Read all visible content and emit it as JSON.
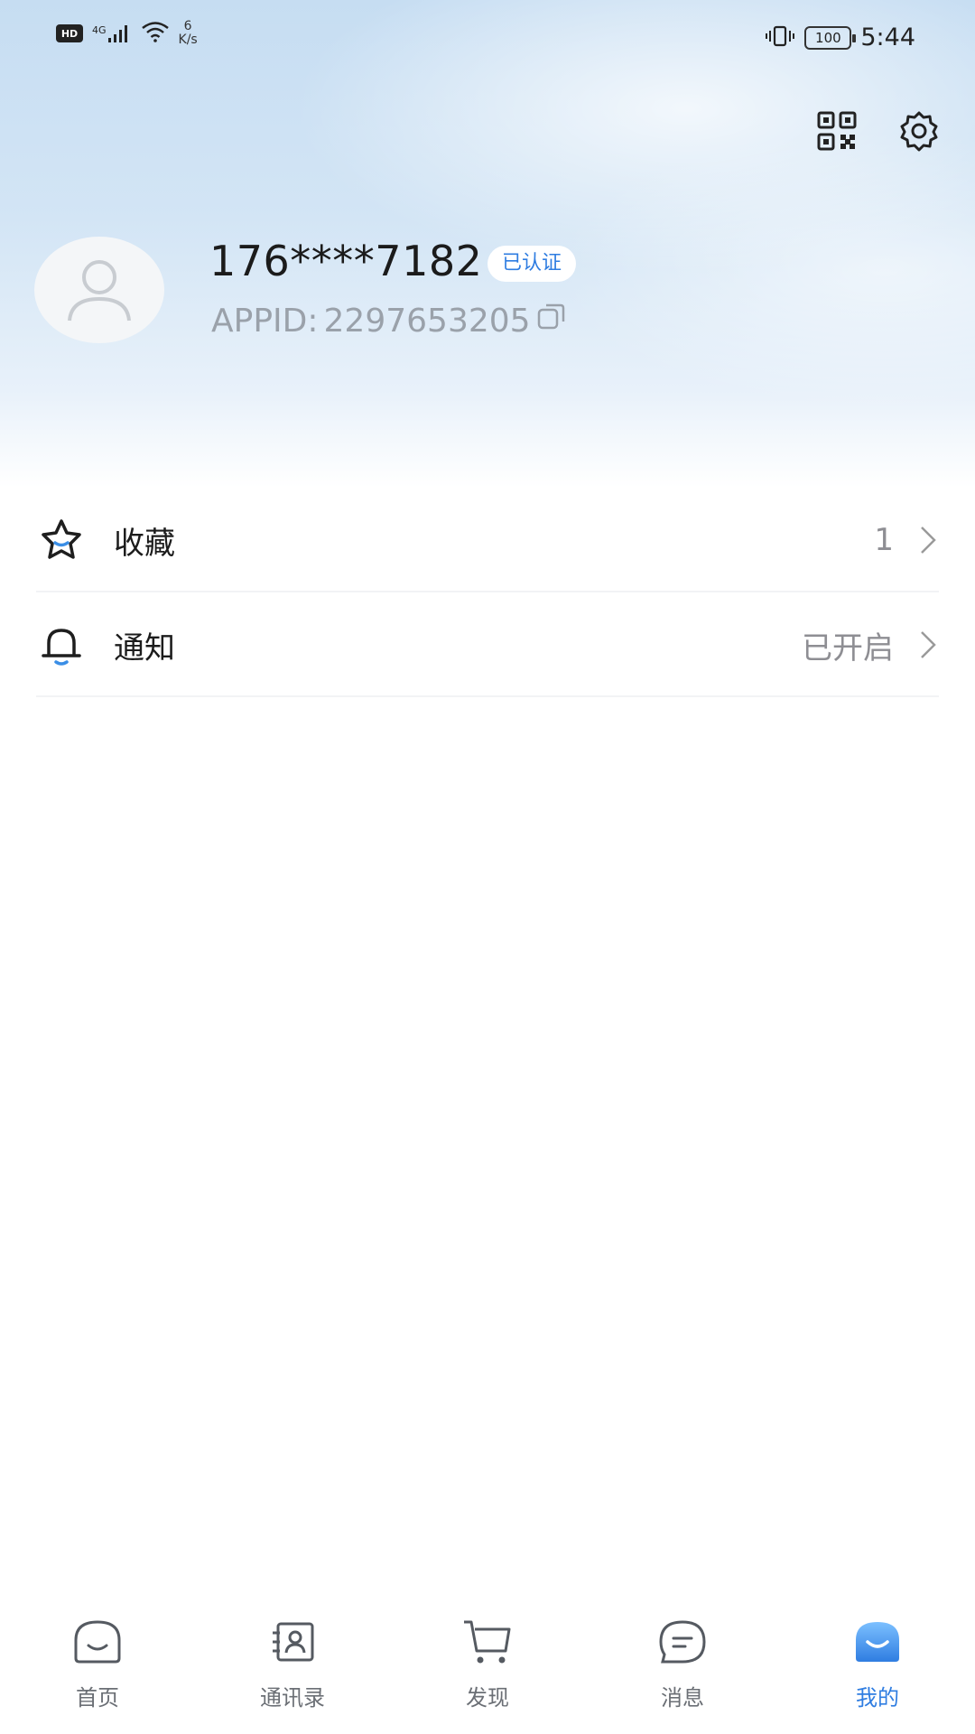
{
  "status_bar": {
    "hd_badge": "HD",
    "network": "4G",
    "speed_value": "6",
    "speed_unit": "K/s",
    "battery": "100",
    "time": "5:44",
    "icons": [
      "vibrate-icon",
      "signal-icon",
      "wifi-icon",
      "battery-icon"
    ]
  },
  "header": {
    "icons": [
      "qr-code-icon",
      "settings-gear-icon"
    ]
  },
  "profile": {
    "phone": "176****7182",
    "verified_label": "已认证",
    "appid_label": "APPID:",
    "appid_value": "2297653205",
    "avatar_icon": "user-avatar-icon",
    "copy_icon": "copy-icon"
  },
  "menu": {
    "items": [
      {
        "label": "收藏",
        "value": "1",
        "icon": "star-icon"
      },
      {
        "label": "通知",
        "value": "已开启",
        "icon": "bell-icon"
      }
    ]
  },
  "bottom_nav": {
    "items": [
      {
        "label": "首页",
        "icon": "home-icon",
        "active": false
      },
      {
        "label": "通讯录",
        "icon": "contacts-icon",
        "active": false
      },
      {
        "label": "发现",
        "icon": "cart-icon",
        "active": false
      },
      {
        "label": "消息",
        "icon": "message-icon",
        "active": false
      },
      {
        "label": "我的",
        "icon": "profile-icon",
        "active": true
      }
    ]
  },
  "colors": {
    "accent": "#2f7de1",
    "text_primary": "#1b1b1b",
    "text_secondary": "#8e8e93"
  }
}
